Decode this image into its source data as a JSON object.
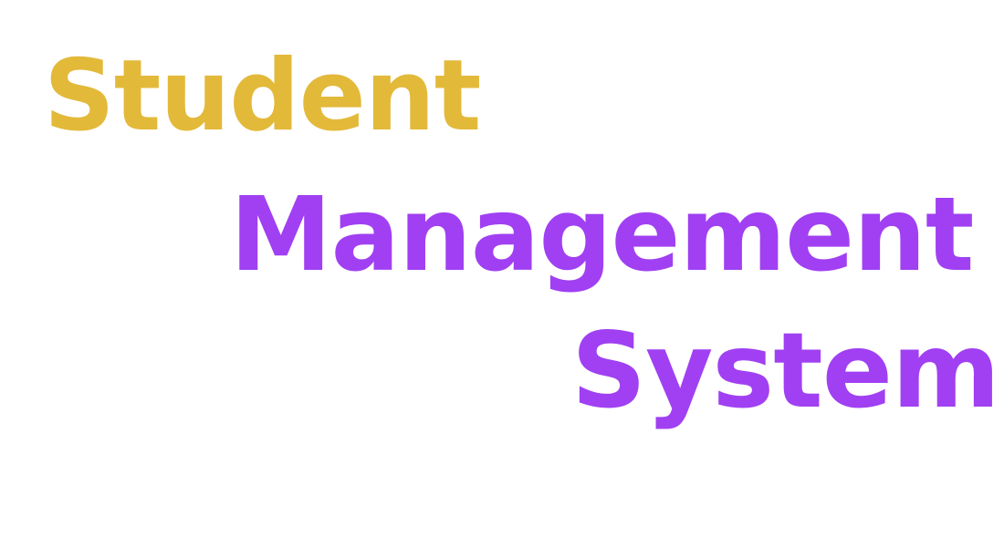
{
  "title": {
    "line1": "Student",
    "line2": "Management",
    "line3": "System"
  },
  "colors": {
    "line1": "#E3B93A",
    "line2": "#A040F2",
    "line3": "#A040F2",
    "background": "#FFFFFF"
  }
}
